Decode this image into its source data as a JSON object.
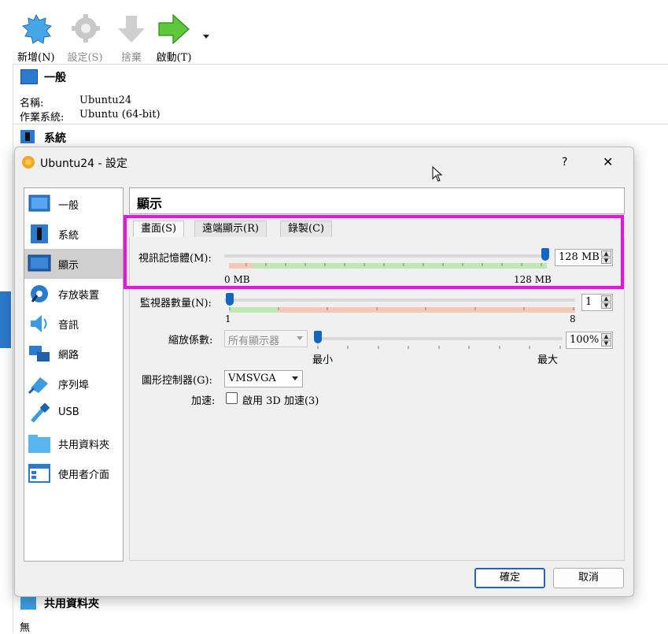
{
  "toolbar": {
    "new_label": "新增(N)",
    "settings_label": "設定(S)",
    "discard_label": "捨棄",
    "start_label": "啟動(T)"
  },
  "details": {
    "general_title": "一般",
    "name_key": "名稱:",
    "name_val": "Ubuntu24",
    "os_key": "作業系統:",
    "os_val": "Ubuntu (64-bit)",
    "system_title": "系統",
    "shared_title": "共用資料夾",
    "shared_val": "無"
  },
  "dialog": {
    "title": "Ubuntu24 - 設定",
    "help": "?",
    "close": "✕",
    "nav": [
      {
        "label": "一般",
        "icon": "general-icon"
      },
      {
        "label": "系統",
        "icon": "system-icon"
      },
      {
        "label": "顯示",
        "icon": "display-icon"
      },
      {
        "label": "存放裝置",
        "icon": "storage-icon"
      },
      {
        "label": "音訊",
        "icon": "audio-icon"
      },
      {
        "label": "網路",
        "icon": "network-icon"
      },
      {
        "label": "序列埠",
        "icon": "serial-port-icon"
      },
      {
        "label": "USB",
        "icon": "usb-icon"
      },
      {
        "label": "共用資料夾",
        "icon": "shared-folder-icon"
      },
      {
        "label": "使用者介面",
        "icon": "user-interface-icon"
      }
    ],
    "selected_nav": "顯示",
    "page_title": "顯示",
    "tabs": [
      "畫面(S)",
      "遠端顯示(R)",
      "錄製(C)"
    ],
    "video_memory": {
      "label": "視訊記憶體(M):",
      "value": "128 MB",
      "min_label": "0 MB",
      "max_label": "128 MB",
      "fraction": 1.0
    },
    "monitors": {
      "label": "監視器數量(N):",
      "value": "1",
      "min_label": "1",
      "max_label": "8",
      "fraction": 0.0
    },
    "scale": {
      "label": "縮放係數:",
      "combo": "所有顯示器",
      "value": "100%",
      "min_label": "最小",
      "max_label": "最大",
      "fraction": 0.0
    },
    "controller": {
      "label": "圖形控制器(G):",
      "value": "VMSVGA"
    },
    "acceleration": {
      "label": "加速:",
      "checkbox_label": "啟用 3D 加速(3)",
      "checked": false
    },
    "ok_label": "確定",
    "cancel_label": "取消"
  },
  "colors": {
    "highlight": "#ee10e0",
    "thumb": "#1466c3",
    "green_zone": "#bfe8b5",
    "red_zone": "#f5c9b8",
    "selected_nav": "#cfcfcf"
  }
}
